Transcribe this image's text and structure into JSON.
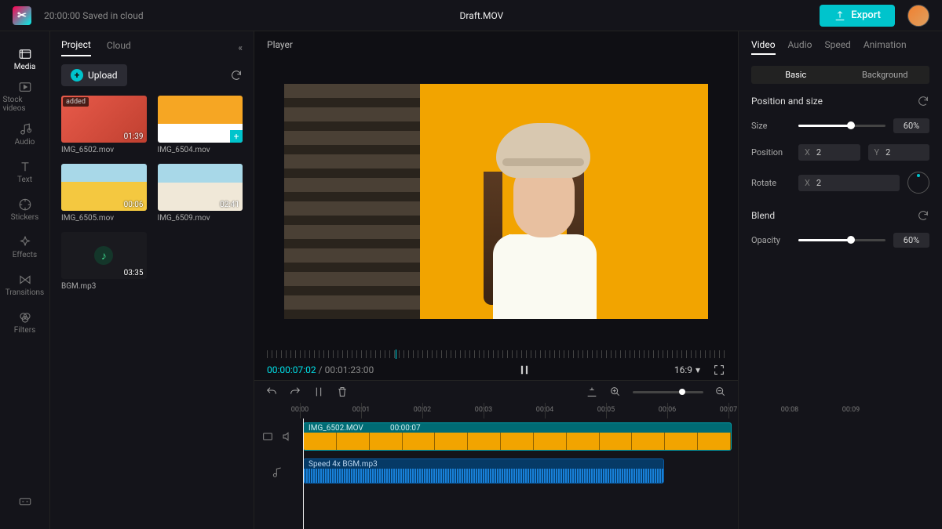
{
  "topbar": {
    "saved_status": "20:00:00 Saved in cloud",
    "title": "Draft.MOV",
    "export_label": "Export"
  },
  "rail": {
    "items": [
      {
        "label": "Media"
      },
      {
        "label": "Stock videos"
      },
      {
        "label": "Audio"
      },
      {
        "label": "Text"
      },
      {
        "label": "Stickers"
      },
      {
        "label": "Effects"
      },
      {
        "label": "Transitions"
      },
      {
        "label": "Filters"
      }
    ]
  },
  "mediaPanel": {
    "tabs": {
      "project": "Project",
      "cloud": "Cloud"
    },
    "upload_label": "Upload",
    "items": [
      {
        "name": "IMG_6502.mov",
        "dur": "01:39",
        "badge": "added"
      },
      {
        "name": "IMG_6504.mov",
        "dur": ""
      },
      {
        "name": "IMG_6505.mov",
        "dur": "00:06"
      },
      {
        "name": "IMG_6509.mov",
        "dur": "02:41"
      },
      {
        "name": "BGM.mp3",
        "dur": "03:35"
      }
    ]
  },
  "player": {
    "label": "Player",
    "current_time": "00:00:07:02",
    "total_time": "00:01:23:00",
    "ratio": "16:9"
  },
  "timeline": {
    "ticks": [
      "00:00",
      "00:01",
      "00:02",
      "00:03",
      "00:04",
      "00:05",
      "00:06",
      "00:07",
      "00:08",
      "00:09"
    ],
    "video_clip": {
      "name": "IMG_6502.MOV",
      "dur": "00:00:07"
    },
    "audio_clip": {
      "label": "Speed 4x   BGM.mp3"
    }
  },
  "props": {
    "tabs": {
      "video": "Video",
      "audio": "Audio",
      "speed": "Speed",
      "animation": "Animation"
    },
    "subtabs": {
      "basic": "Basic",
      "background": "Background"
    },
    "section_pos": "Position and size",
    "size": {
      "label": "Size",
      "value": "60%"
    },
    "position": {
      "label": "Position",
      "x": "2",
      "y": "2"
    },
    "rotate": {
      "label": "Rotate",
      "x": "2"
    },
    "section_blend": "Blend",
    "opacity": {
      "label": "Opacity",
      "value": "60%"
    }
  }
}
